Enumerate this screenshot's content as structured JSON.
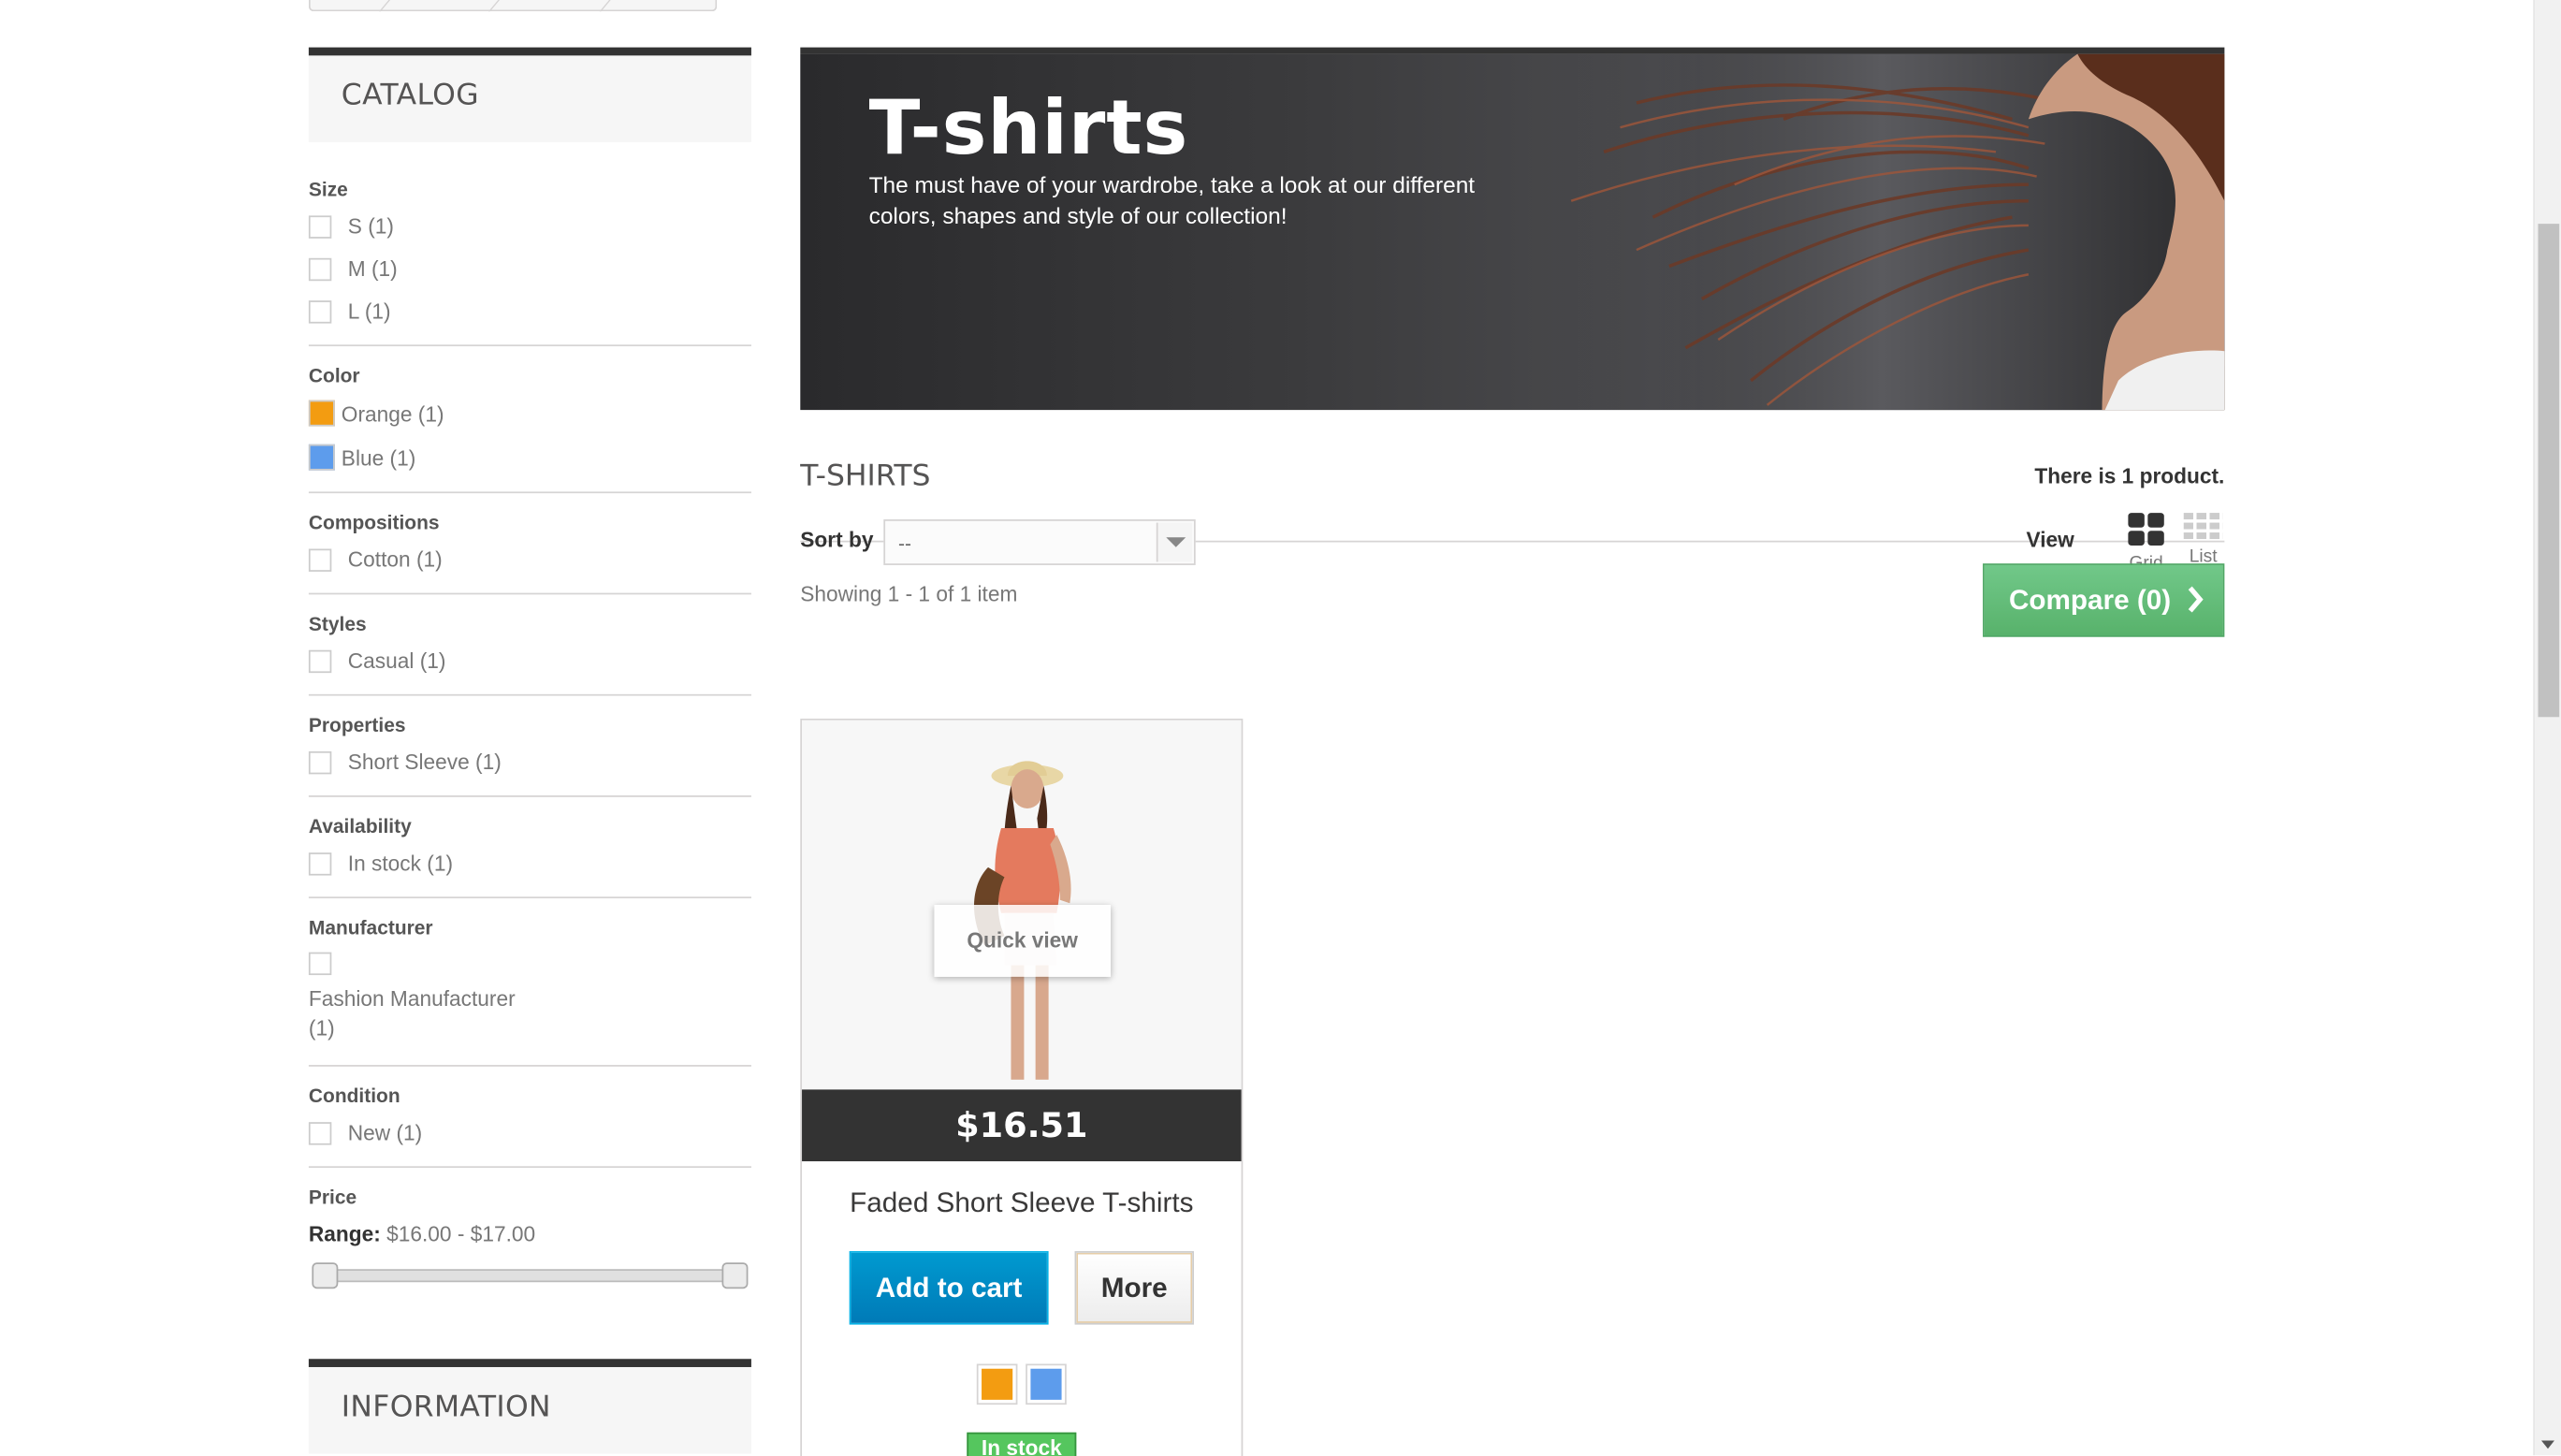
{
  "sidebar": {
    "catalog_title": "CATALOG",
    "information_title": "INFORMATION",
    "size": {
      "title": "Size",
      "options": [
        "S (1)",
        "M (1)",
        "L (1)"
      ]
    },
    "color": {
      "title": "Color",
      "options": [
        {
          "label": "Orange (1)",
          "color": "#f39c11"
        },
        {
          "label": "Blue (1)",
          "color": "#5d9cec"
        }
      ]
    },
    "compositions": {
      "title": "Compositions",
      "options": [
        "Cotton (1)"
      ]
    },
    "styles": {
      "title": "Styles",
      "options": [
        "Casual (1)"
      ]
    },
    "properties": {
      "title": "Properties",
      "options": [
        "Short Sleeve (1)"
      ]
    },
    "availability": {
      "title": "Availability",
      "options": [
        "In stock (1)"
      ]
    },
    "manufacturer": {
      "title": "Manufacturer",
      "options": [
        "Fashion Manufacturer",
        "(1)"
      ]
    },
    "condition": {
      "title": "Condition",
      "options": [
        "New (1)"
      ]
    },
    "price": {
      "title": "Price",
      "range_label": "Range:",
      "range_value": "$16.00 - $17.00"
    }
  },
  "banner": {
    "title": "T-shirts",
    "description": "The must have of your wardrobe, take a look at our different colors, shapes and style of our collection!"
  },
  "listing": {
    "category_name": "T-SHIRTS",
    "product_count": "There is 1 product.",
    "sort_label": "Sort by",
    "sort_value": "--",
    "view_label": "View",
    "view_grid": "Grid",
    "view_list": "List",
    "showing": "Showing 1 - 1 of 1 item",
    "compare_label": "Compare (0)"
  },
  "product": {
    "quick_view": "Quick view",
    "price": "$16.51",
    "name": "Faded Short Sleeve T-shirts",
    "add_to_cart": "Add to cart",
    "more": "More",
    "colors": [
      "#f39c11",
      "#5d9cec"
    ],
    "stock": "In stock"
  },
  "colors": {
    "accent_blue": "#0079b6",
    "compare_green": "#5fbc71",
    "dark": "#333333"
  }
}
